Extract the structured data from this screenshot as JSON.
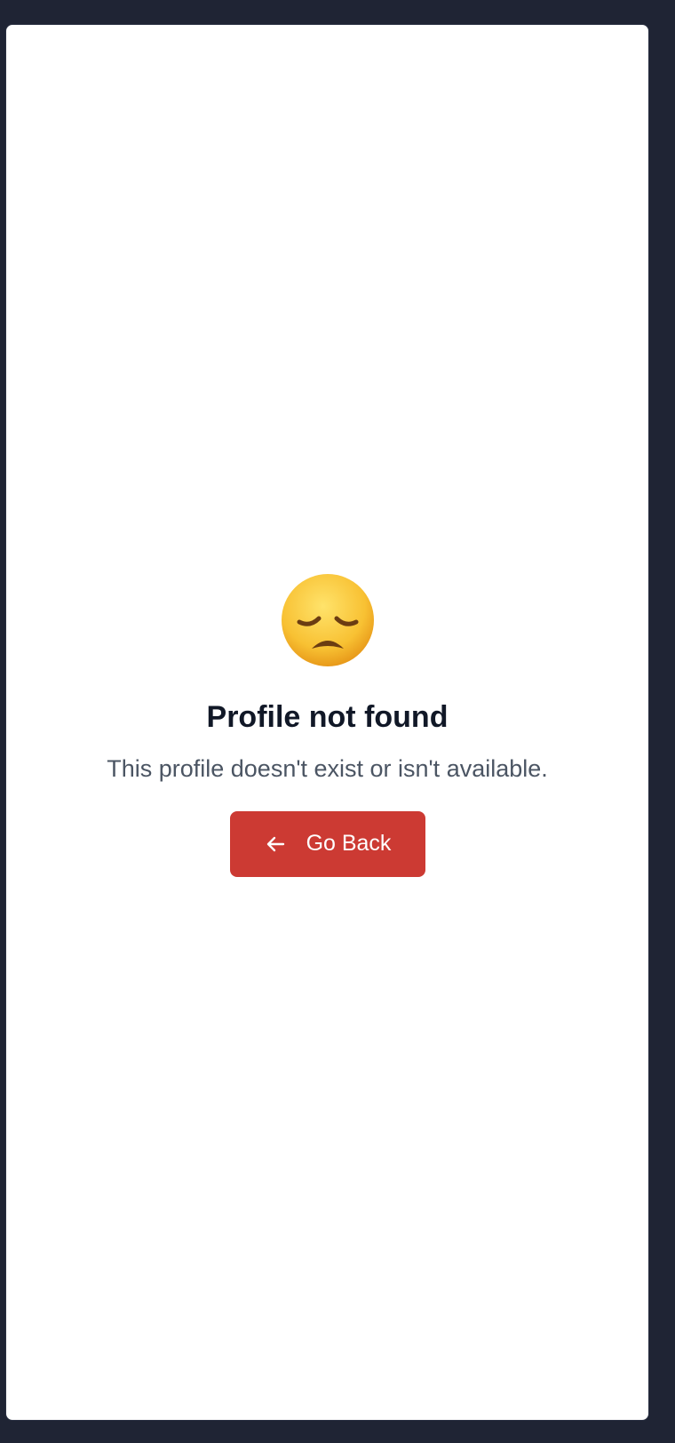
{
  "page": {
    "background_color": "#1f2434",
    "card_color": "#ffffff"
  },
  "empty_state": {
    "emoji_icon": "disappointed-face-icon",
    "title": "Profile not found",
    "message": "This profile doesn't exist or isn't available.",
    "back_button": {
      "label": "Go Back",
      "icon": "arrow-left-icon",
      "color": "#cc3a33"
    }
  }
}
